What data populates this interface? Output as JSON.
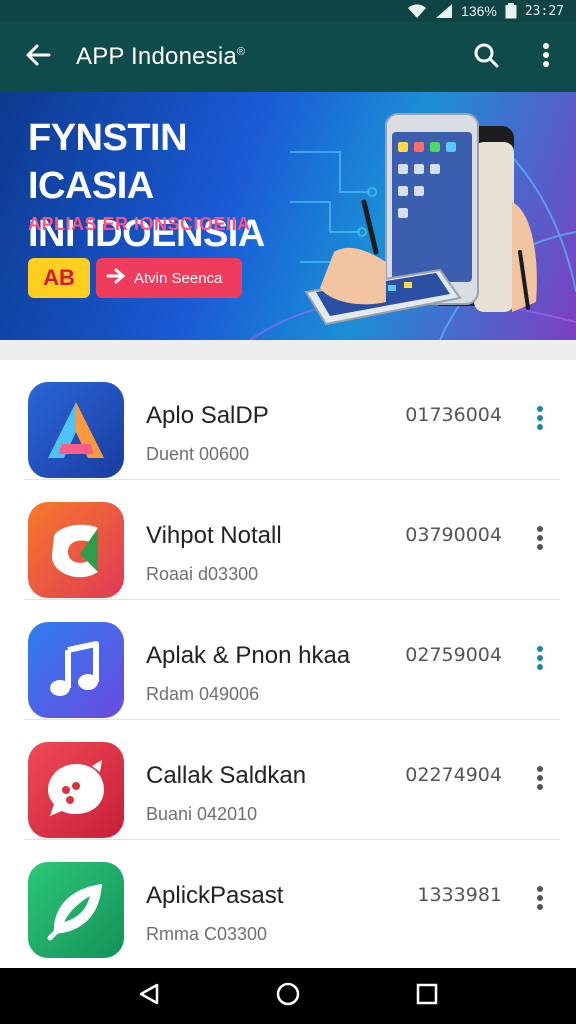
{
  "status_bar": {
    "battery": "136%",
    "time": "23:27",
    "icons": [
      "wifi-icon",
      "signal-icon",
      "battery-icon"
    ]
  },
  "app_bar": {
    "title": "APP Indonesia",
    "title_mark": "®",
    "back_icon": "arrow-left-icon",
    "search_icon": "search-icon",
    "menu_icon": "more-vert-icon"
  },
  "banner": {
    "headline_line1": "FYNSTIN ICASIA",
    "headline_line2": "INI IDOENSIA",
    "subtitle": "APLIAS ER IONSCIOEIIA",
    "badge": "AB",
    "cta_label": "Atvin Seenca"
  },
  "apps": [
    {
      "name": "Aplo SalDP",
      "desc": "Duent 00600",
      "num": "01736004",
      "icon": "letter-a-app-icon",
      "colors": [
        "#1e4fb8",
        "#ff9a3c"
      ]
    },
    {
      "name": "Vihpot Notall",
      "desc": "Roaai d03300",
      "num": "03790004",
      "icon": "leaf-g-app-icon",
      "colors": [
        "#f06a2a",
        "#d63a5a"
      ]
    },
    {
      "name": "Aplak & Pnon hkaa",
      "desc": "Rdam 049006",
      "num": "02759004",
      "icon": "music-note-app-icon",
      "colors": [
        "#2f7ef0",
        "#6a4ae0"
      ]
    },
    {
      "name": "Callak Saldkan",
      "desc": "Buani 042010",
      "num": "02274904",
      "icon": "chat-bubble-app-icon",
      "colors": [
        "#ef3a4a",
        "#c81e3a"
      ]
    },
    {
      "name": "AplickPasast",
      "desc": "Rmma C03300",
      "num": "1333981",
      "icon": "leaf-app-icon",
      "colors": [
        "#22b36a",
        "#14925a"
      ]
    }
  ],
  "nav_bar": {
    "back": "triangle-back-icon",
    "home": "circle-home-icon",
    "recents": "square-recents-icon"
  },
  "colors": {
    "app_bar": "#0f4b4b",
    "status_bar": "#0e4444",
    "accent_dots": "#1a8aa0"
  }
}
